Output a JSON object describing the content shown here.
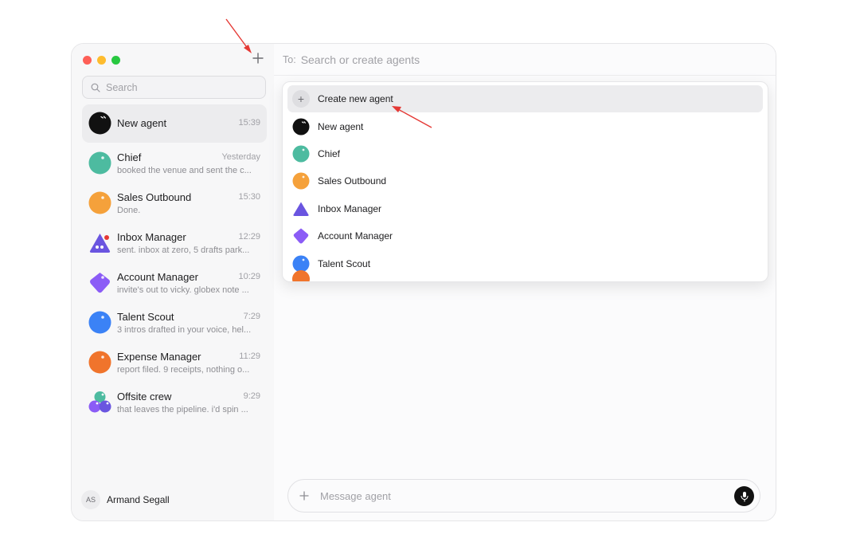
{
  "sidebar": {
    "new_agent_icon": "plus-icon",
    "search": {
      "placeholder": "Search"
    },
    "agents": [
      {
        "name": "New agent",
        "time": "15:39",
        "preview": "",
        "avatar": "black-face",
        "color": "#111111",
        "active": true
      },
      {
        "name": "Chief",
        "time": "Yesterday",
        "preview": "booked the venue and sent the c...",
        "avatar": "circle",
        "color": "#4dbba0"
      },
      {
        "name": "Sales Outbound",
        "time": "15:30",
        "preview": "Done.",
        "avatar": "circle",
        "color": "#f5a13b"
      },
      {
        "name": "Inbox Manager",
        "time": "12:29",
        "preview": "sent. inbox at zero, 5 drafts park...",
        "avatar": "triangle",
        "color": "#6a55e0"
      },
      {
        "name": "Account Manager",
        "time": "10:29",
        "preview": "invite's out to vicky. globex note ...",
        "avatar": "blob",
        "color": "#8b5cf6"
      },
      {
        "name": "Talent Scout",
        "time": "7:29",
        "preview": "3 intros drafted in your voice, hel...",
        "avatar": "circle",
        "color": "#3b82f6"
      },
      {
        "name": "Expense Manager",
        "time": "11:29",
        "preview": "report filed. 9 receipts, nothing o...",
        "avatar": "circle",
        "color": "#f0742c"
      },
      {
        "name": "Offsite crew",
        "time": "9:29",
        "preview": "that leaves the pipeline. i'd spin ...",
        "avatar": "group",
        "color": "#8b5cf6"
      }
    ],
    "user": {
      "initials": "AS",
      "name": "Armand Segall"
    }
  },
  "main": {
    "to_label": "To:",
    "to_placeholder": "Search or create agents",
    "dropdown": {
      "create_label": "Create new agent",
      "items": [
        {
          "name": "New agent",
          "color": "#111111",
          "avatar": "black-face"
        },
        {
          "name": "Chief",
          "color": "#4dbba0",
          "avatar": "circle"
        },
        {
          "name": "Sales Outbound",
          "color": "#f5a13b",
          "avatar": "circle"
        },
        {
          "name": "Inbox Manager",
          "color": "#6a55e0",
          "avatar": "triangle"
        },
        {
          "name": "Account Manager",
          "color": "#8b5cf6",
          "avatar": "blob"
        },
        {
          "name": "Talent Scout",
          "color": "#3b82f6",
          "avatar": "circle"
        }
      ]
    },
    "composer": {
      "placeholder": "Message agent",
      "mic_icon": "microphone-icon",
      "attach_icon": "plus-icon"
    }
  },
  "colors": {
    "annotation_arrow": "#e53935"
  }
}
